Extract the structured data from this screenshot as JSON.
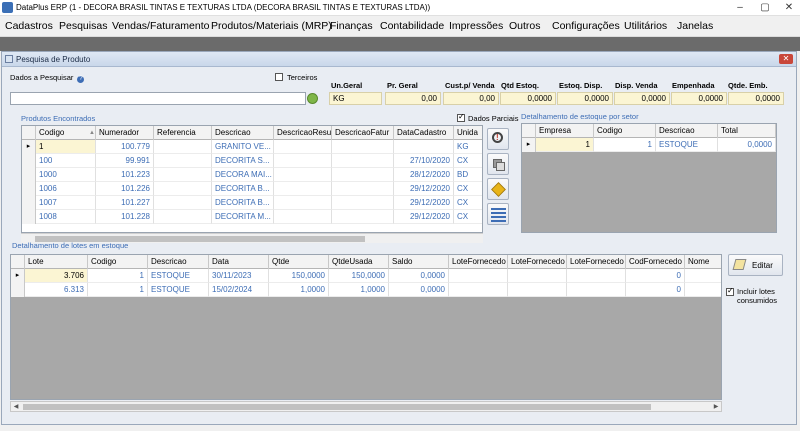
{
  "app": {
    "title": "DataPlus ERP (1 - DECORA BRASIL TINTAS E TEXTURAS LTDA  (DECORA BRASIL TINTAS E TEXTURAS LTDA))"
  },
  "menu": [
    "Cadastros",
    "Pesquisas",
    "Vendas/Faturamento",
    "Produtos/Materiais (MRP)",
    "Finanças",
    "Contabilidade",
    "Impressões",
    "Outros",
    "Configurações",
    "Utilitários",
    "Janelas"
  ],
  "window": {
    "title": "Pesquisa de Produto",
    "close_label": "✕"
  },
  "search": {
    "label": "Dados a Pesquisar",
    "value": "",
    "terceiros_label": "Terceiros"
  },
  "summary": {
    "labels": [
      "Un.Geral",
      "Pr. Geral",
      "Cust.p/ Venda",
      "Qtd Estoq.",
      "Estoq. Disp.",
      "Disp. Venda",
      "Empenhada",
      "Qtde. Emb."
    ],
    "values": [
      "KG",
      "0,00",
      "0,00",
      "0,0000",
      "0,0000",
      "0,0000",
      "0,0000",
      "0,0000"
    ]
  },
  "produtos": {
    "title": "Produtos Encontrados",
    "dados_parciais_label": "Dados Parciais",
    "columns": [
      "Codigo",
      "Numerador",
      "Referencia",
      "Descricao",
      "DescricaoResu",
      "DescricaoFatur",
      "DataCadastro",
      "Unida"
    ],
    "rows": [
      [
        "1",
        "100.779",
        "",
        "GRANITO VE...",
        "",
        "",
        "",
        "KG"
      ],
      [
        "100",
        "99.991",
        "",
        "DECORITA S...",
        "",
        "",
        "27/10/2020",
        "CX"
      ],
      [
        "1000",
        "101.223",
        "",
        "DECORA MAI...",
        "",
        "",
        "28/12/2020",
        "BD"
      ],
      [
        "1006",
        "101.226",
        "",
        "DECORITA B...",
        "",
        "",
        "29/12/2020",
        "CX"
      ],
      [
        "1007",
        "101.227",
        "",
        "DECORITA B...",
        "",
        "",
        "29/12/2020",
        "CX"
      ],
      [
        "1008",
        "101.228",
        "",
        "DECORITA M...",
        "",
        "",
        "29/12/2020",
        "CX"
      ]
    ]
  },
  "setor": {
    "title": "Detalhamento de estoque por setor",
    "columns": [
      "Empresa",
      "Codigo",
      "Descricao",
      "Total"
    ],
    "rows": [
      [
        "1",
        "1",
        "ESTOQUE",
        "0,0000"
      ]
    ]
  },
  "lotes": {
    "title": "Detalhamento de lotes em estoque",
    "columns": [
      "Lote",
      "Codigo",
      "Descricao",
      "Data",
      "Qtde",
      "QtdeUsada",
      "Saldo",
      "LoteFornecedo",
      "LoteFornecedo",
      "LoteFornecedo",
      "CodFornecedo",
      "Nome"
    ],
    "rows": [
      [
        "3.706",
        "1",
        "ESTOQUE",
        "30/11/2023",
        "150,0000",
        "150,0000",
        "0,0000",
        "",
        "",
        "",
        "0",
        ""
      ],
      [
        "6.313",
        "1",
        "ESTOQUE",
        "15/02/2024",
        "1,0000",
        "1,0000",
        "0,0000",
        "",
        "",
        "",
        "0",
        ""
      ]
    ],
    "editar_label": "Editar",
    "incluir_label": "Incluir lotes consumidos"
  },
  "colors": {
    "accent_blue": "#3d6db5",
    "selected_cell": "#fbf5d3"
  }
}
